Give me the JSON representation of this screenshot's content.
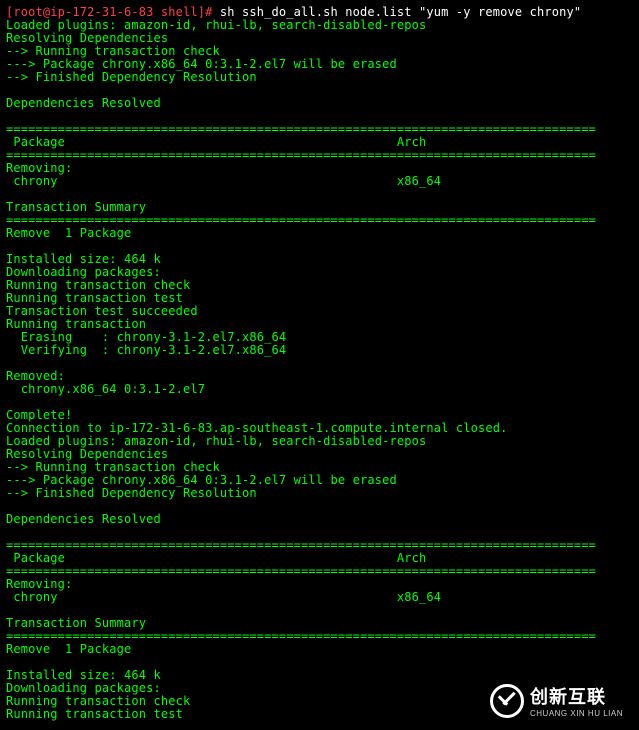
{
  "prompt": "[root@ip-172-31-6-83 shell]# ",
  "command": "sh ssh_do_all.sh node.list \"yum -y remove chrony\"",
  "hr": "================================================================================",
  "pkg_header": " Package                                             Arch",
  "removing_label": "Removing:",
  "pkg_row": " chrony                                              x86_64",
  "lines1": [
    "Loaded plugins: amazon-id, rhui-lb, search-disabled-repos",
    "Resolving Dependencies",
    "--> Running transaction check",
    "---> Package chrony.x86_64 0:3.1-2.el7 will be erased",
    "--> Finished Dependency Resolution",
    "",
    "Dependencies Resolved",
    ""
  ],
  "trans_summary": "Transaction Summary",
  "remove_pkg": "Remove  1 Package",
  "lines2": [
    "Installed size: 464 k",
    "Downloading packages:",
    "Running transaction check",
    "Running transaction test",
    "Transaction test succeeded",
    "Running transaction",
    "  Erasing    : chrony-3.1-2.el7.x86_64",
    "  Verifying  : chrony-3.1-2.el7.x86_64",
    "",
    "Removed:",
    "  chrony.x86_64 0:3.1-2.el7",
    "",
    "Complete!",
    "Connection to ip-172-31-6-83.ap-southeast-1.compute.internal closed.",
    "Loaded plugins: amazon-id, rhui-lb, search-disabled-repos",
    "Resolving Dependencies",
    "--> Running transaction check",
    "---> Package chrony.x86_64 0:3.1-2.el7 will be erased",
    "--> Finished Dependency Resolution",
    "",
    "Dependencies Resolved",
    ""
  ],
  "lines3": [
    "Installed size: 464 k",
    "Downloading packages:",
    "Running transaction check",
    "Running transaction test"
  ],
  "logo": {
    "big": "创新互联",
    "small": "CHUANG XIN HU LIAN"
  }
}
